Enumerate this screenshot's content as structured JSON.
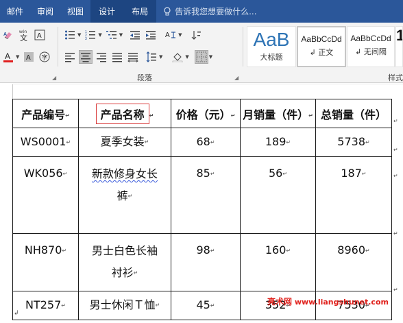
{
  "ribbon_tabs": [
    {
      "label": "邮件",
      "active": false
    },
    {
      "label": "审阅",
      "active": false
    },
    {
      "label": "视图",
      "active": false
    },
    {
      "label": "设计",
      "active": true
    },
    {
      "label": "布局",
      "active": true
    }
  ],
  "tell_me": {
    "placeholder": "告诉我您想要做什么..."
  },
  "ribbon": {
    "groups": {
      "paragraph": "段落",
      "styles": "样式"
    },
    "phonetic_glyph": "文",
    "enclose_glyph": "字",
    "styles": [
      {
        "preview": "AaB",
        "name": "大标题"
      },
      {
        "preview": "AaBbCcDd",
        "name": "↲ 正文"
      },
      {
        "preview": "AaBbCcDd",
        "name": "↲ 无间隔"
      }
    ],
    "styles_more_glyph": "1"
  },
  "table": {
    "headers": [
      "产品编号",
      "产品名称",
      "价格（元）",
      "月销量（件）",
      "总销量（件）"
    ],
    "rows": [
      {
        "id": "WS0001",
        "name_lines": [
          "夏季女装"
        ],
        "price": "68",
        "monthly": "189",
        "total": "5738"
      },
      {
        "id": "WK056",
        "name_lines": [
          "新款修身女长",
          "裤"
        ],
        "price": "85",
        "monthly": "56",
        "total": "187"
      },
      {
        "id": "NH870",
        "name_lines": [
          "男士白色长袖",
          "衬衫"
        ],
        "price": "98",
        "monthly": "160",
        "total": "8960"
      },
      {
        "id": "NT257",
        "name_lines": [
          "男士休闲Ｔ恤"
        ],
        "price": "45",
        "monthly": "352",
        "total": "7530"
      }
    ]
  },
  "paragraph_mark": "↲",
  "cell_mark": "↵",
  "watermark": {
    "site_name": "亮术网",
    "url": "www.liangshunet.com"
  },
  "colors": {
    "tab_bar": "#2b579a",
    "tab_active": "#1d4581",
    "header_highlight": "#d93a3a",
    "watermark": "#e0201b",
    "style_heading": "#2e74b5"
  }
}
